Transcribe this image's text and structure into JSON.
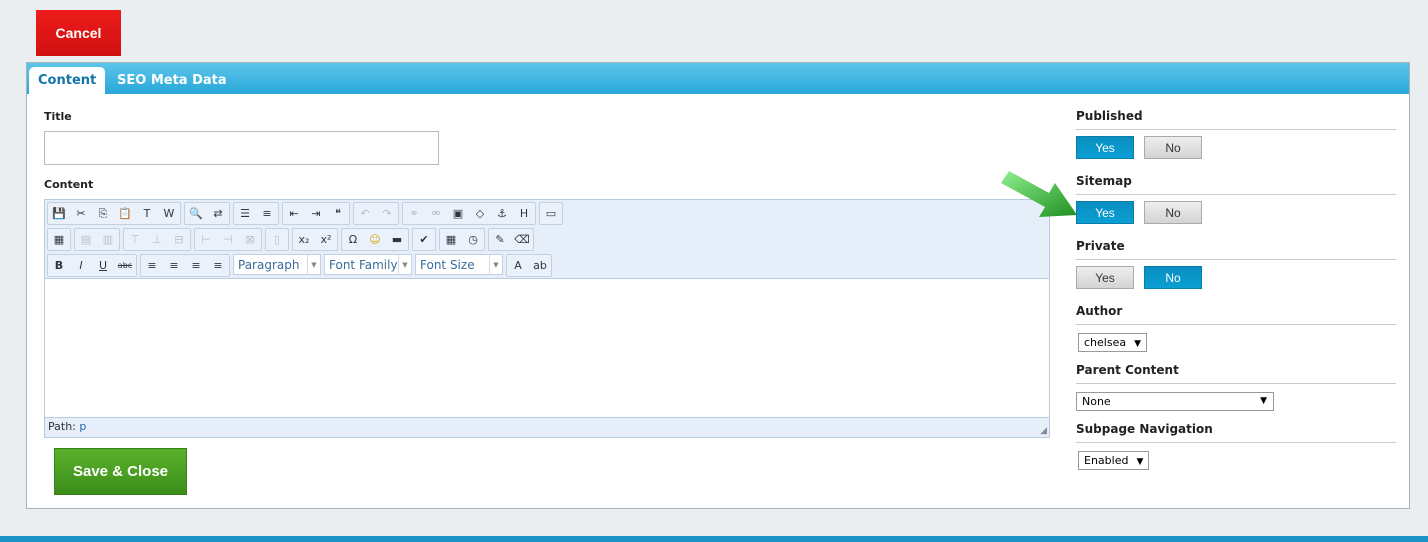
{
  "cancel_label": "Cancel",
  "tabs": [
    {
      "label": "Content"
    },
    {
      "label": "SEO Meta Data"
    }
  ],
  "form": {
    "title_label": "Title",
    "title_value": "",
    "content_label": "Content",
    "path_label": "Path:",
    "path_value": "p",
    "save_label": "Save & Close"
  },
  "toolbar": {
    "row1": [
      [
        "save",
        "cut",
        "copy",
        "paste",
        "paste-text",
        "paste-word"
      ],
      [
        "find",
        "replace"
      ],
      [
        "bullet-list",
        "numbered-list"
      ],
      [
        "outdent",
        "indent",
        "blockquote"
      ],
      [
        "undo:dis",
        "redo:dis"
      ],
      [
        "link:dis",
        "unlink:dis",
        "image",
        "code",
        "anchor",
        "html"
      ],
      [
        "fullscreen"
      ]
    ],
    "row2": [
      [
        "table"
      ],
      [
        "row-props:dis",
        "cell-props:dis"
      ],
      [
        "insert-row-before:dis",
        "insert-row-after:dis",
        "delete-row:dis"
      ],
      [
        "insert-col-before:dis",
        "insert-col-after:dis",
        "delete-col:dis"
      ],
      [
        "merge-cells:dis"
      ],
      [
        "subscript",
        "superscript"
      ],
      [
        "special-char",
        "emoticon",
        "horizontal-rule"
      ],
      [
        "spellcheck"
      ],
      [
        "insert-date",
        "insert-time"
      ],
      [
        "cleanup",
        "remove-format"
      ]
    ],
    "row3_a": [
      [
        "bold",
        "italic",
        "underline",
        "strikethrough"
      ],
      [
        "align-left",
        "align-center",
        "align-right",
        "align-justify"
      ]
    ],
    "selects": [
      "Paragraph",
      "Font Family",
      "Font Size"
    ],
    "row3_b": [
      [
        "text-color",
        "highlight-color"
      ]
    ]
  },
  "right": {
    "published": {
      "label": "Published",
      "yes": "Yes",
      "no": "No",
      "value": "Yes"
    },
    "sitemap": {
      "label": "Sitemap",
      "yes": "Yes",
      "no": "No",
      "value": "Yes"
    },
    "private": {
      "label": "Private",
      "yes": "Yes",
      "no": "No",
      "value": "No"
    },
    "author": {
      "label": "Author",
      "value": "chelsea"
    },
    "parent": {
      "label": "Parent Content",
      "value": "None"
    },
    "subpage": {
      "label": "Subpage Navigation",
      "value": "Enabled"
    }
  },
  "colors": {
    "accent": "#0a9fd3",
    "cancel": "#e01717",
    "save": "#4a9f22",
    "arrow": "#2ea82e"
  }
}
